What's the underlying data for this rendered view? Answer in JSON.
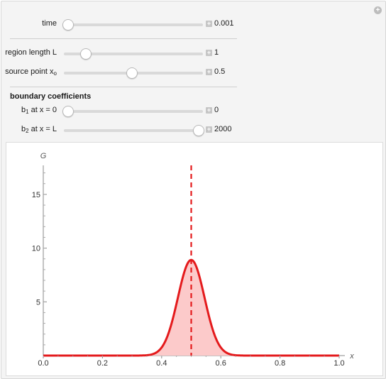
{
  "controls": {
    "time": {
      "label": "time",
      "value": "0.001",
      "fraction": 0.03
    },
    "region_length": {
      "label": "region length L",
      "value": "1",
      "fraction": 0.16
    },
    "source_point": {
      "label": "source point x",
      "label_sub": "o",
      "value": "0.5",
      "fraction": 0.49
    },
    "section_title": "boundary coefficients",
    "b1": {
      "label_main": "b",
      "label_sub": "1",
      "label_rest": " at x = 0",
      "value": "0",
      "fraction": 0.03
    },
    "b2": {
      "label_main": "b",
      "label_sub": "2",
      "label_rest": " at x = L",
      "value": "2000",
      "fraction": 0.97
    }
  },
  "icons": {
    "corner": "plus-circle-icon",
    "increment": "plus-square-icon"
  },
  "chart_data": {
    "type": "area",
    "xlabel": "x",
    "ylabel": "G",
    "xlim": [
      0,
      1
    ],
    "ylim": [
      0,
      17.7
    ],
    "xticks": [
      "0.0",
      "0.2",
      "0.4",
      "0.6",
      "0.8",
      "1.0"
    ],
    "yticks": [
      "5",
      "10",
      "15"
    ],
    "series": [
      {
        "curve": "gaussian",
        "center": 0.5,
        "peak": 8.9,
        "sigma": 0.045,
        "color": "#e41a1c",
        "fill": "#fccaca"
      }
    ],
    "marker_line": {
      "x": 0.5,
      "style": "dashed",
      "color": "#e41a1c"
    }
  }
}
